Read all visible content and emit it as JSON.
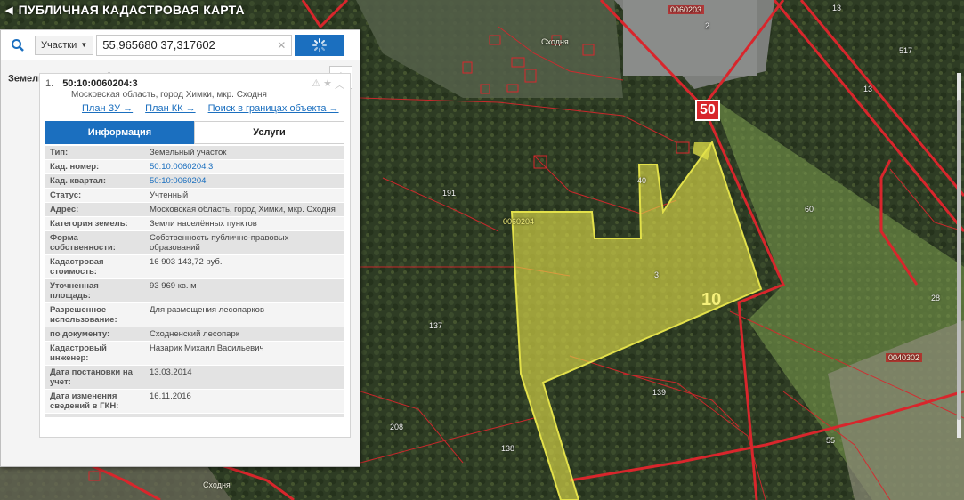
{
  "app": {
    "title": "ПУБЛИЧНАЯ КАДАСТРОВАЯ КАРТА"
  },
  "search": {
    "category": "Участки",
    "query": "55,965680 37,317602"
  },
  "results": {
    "title": "Земельные участки",
    "count": "1"
  },
  "result": {
    "index": "1.",
    "cad_number": "50:10:0060204:3",
    "address": "Московская область, город Химки, мкр. Сходня",
    "links": [
      "План ЗУ →",
      "План КК →",
      "Поиск в границах объекта →"
    ]
  },
  "tabs": {
    "info": "Информация",
    "services": "Услуги"
  },
  "info_rows": [
    {
      "key": "Тип:",
      "value": "Земельный участок",
      "link": false
    },
    {
      "key": "Кад. номер:",
      "value": "50:10:0060204:3",
      "link": true
    },
    {
      "key": "Кад. квартал:",
      "value": "50:10:0060204",
      "link": true
    },
    {
      "key": "Статус:",
      "value": "Учтенный",
      "link": false
    },
    {
      "key": "Адрес:",
      "value": "Московская область, город Химки, мкр. Сходня",
      "link": false
    },
    {
      "key": "Категория земель:",
      "value": "Земли населённых пунктов",
      "link": false
    },
    {
      "key": "Форма собственности:",
      "value": "Собственность публично-правовых образований",
      "link": false
    },
    {
      "key": "Кадастровая стоимость:",
      "value": "16 903 143,72 руб.",
      "link": false
    },
    {
      "key": "Уточненная площадь:",
      "value": "93 969 кв. м",
      "link": false
    },
    {
      "key": "Разрешенное использование:",
      "value": "Для размещения лесопарков",
      "link": false
    },
    {
      "key": "по документу:",
      "value": "Сходненский лесопарк",
      "link": false
    },
    {
      "key": "Кадастровый инженер:",
      "value": "Назарик Михаил Васильевич",
      "link": false
    },
    {
      "key": "Дата постановки на учет:",
      "value": "13.03.2014",
      "link": false
    },
    {
      "key": "Дата изменения сведений в ГКН:",
      "value": "16.11.2016",
      "link": false
    },
    {
      "key": "",
      "value": "",
      "link": false
    }
  ],
  "map": {
    "labels": [
      {
        "text": "Сходня",
        "kind": "dark"
      },
      {
        "text": "Сходня",
        "kind": "dark"
      },
      {
        "text": "60",
        "kind": "plain"
      },
      {
        "text": "40",
        "kind": "plain"
      },
      {
        "text": "3",
        "kind": "plain"
      },
      {
        "text": "191",
        "kind": "plain"
      },
      {
        "text": "137",
        "kind": "plain"
      },
      {
        "text": "139",
        "kind": "plain"
      },
      {
        "text": "138",
        "kind": "plain"
      },
      {
        "text": "208",
        "kind": "plain"
      },
      {
        "text": "55",
        "kind": "plain"
      },
      {
        "text": "28",
        "kind": "plain"
      },
      {
        "text": "517",
        "kind": "plain"
      },
      {
        "text": "13",
        "kind": "plain"
      },
      {
        "text": "0060204",
        "kind": "plain"
      },
      {
        "text": "0060203",
        "kind": "red-box"
      },
      {
        "text": "0040302",
        "kind": "red-box"
      },
      {
        "text": "2",
        "kind": "plain"
      },
      {
        "text": "13",
        "kind": "plain"
      }
    ],
    "road_number": "50",
    "parcel_number": "10"
  },
  "colors": {
    "accent": "#1b6fbf",
    "parcel_fill": "#e3e14a",
    "boundary_red": "#d8262c"
  }
}
